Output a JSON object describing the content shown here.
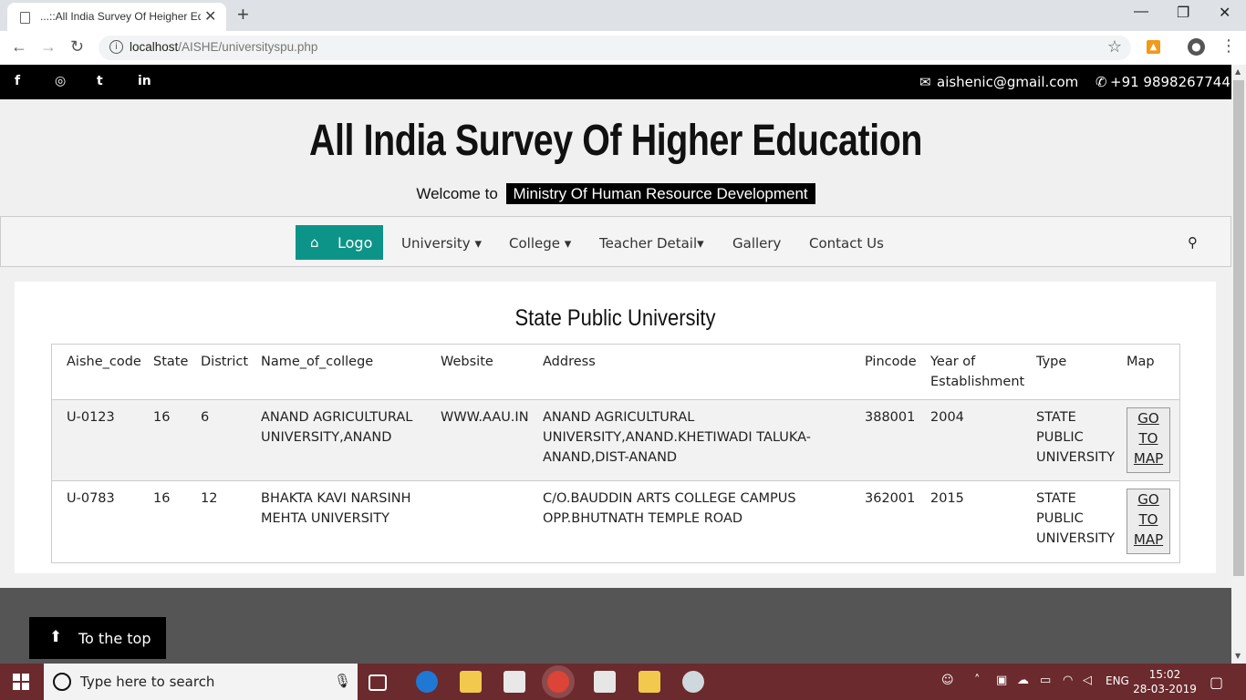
{
  "browser": {
    "tab_title": "...::All India Survey Of Heigher Ed",
    "tab_close": "✕",
    "new_tab": "+",
    "url_host": "localhost",
    "url_path": "/AISHE/universityspu.php",
    "controls": {
      "minimize": "—",
      "maximize": "❐",
      "close": "✕"
    },
    "nav": {
      "back": "←",
      "forward": "→",
      "reload": "↻"
    }
  },
  "topbar": {
    "social": [
      "f",
      "◎",
      "t",
      "in"
    ],
    "email": "aishenic@gmail.com",
    "phone": "+91 9898267744"
  },
  "header": {
    "title": "All India Survey Of Higher Education",
    "welcome": "Welcome to",
    "ministry": "Ministry Of Human Resource Development"
  },
  "nav": {
    "home": "Logo",
    "items": [
      "University",
      "College",
      "Teacher Detail",
      "Gallery",
      "Contact Us"
    ],
    "dropdown_caret": "▾"
  },
  "main": {
    "heading": "State Public University",
    "columns": [
      "Aishe_code",
      "State",
      "District",
      "Name_of_college",
      "Website",
      "Address",
      "Pincode",
      "Year of Establishment",
      "Type",
      "Map"
    ],
    "rows": [
      {
        "aishe_code": "U-0123",
        "state": "16",
        "district": "6",
        "name": "ANAND AGRICULTURAL UNIVERSITY,ANAND",
        "website": "WWW.AAU.IN",
        "address": "ANAND AGRICULTURAL UNIVERSITY,ANAND.KHETIWADI TALUKA-ANAND,DIST-ANAND",
        "pincode": "388001",
        "year": "2004",
        "type": "STATE PUBLIC UNIVERSITY",
        "map": "GO TO MAP"
      },
      {
        "aishe_code": "U-0783",
        "state": "16",
        "district": "12",
        "name": "BHAKTA KAVI NARSINH MEHTA UNIVERSITY",
        "website": "",
        "address": "C/O.BAUDDIN ARTS COLLEGE CAMPUS OPP.BHUTNATH TEMPLE ROAD",
        "pincode": "362001",
        "year": "2015",
        "type": "STATE PUBLIC UNIVERSITY",
        "map": "GO TO MAP"
      }
    ]
  },
  "to_top": "To the top",
  "taskbar": {
    "search_placeholder": "Type here to search",
    "lang": "ENG",
    "time": "15:02",
    "date": "28-03-2019"
  },
  "colors": {
    "accent": "#0d9488",
    "topbar": "#000000",
    "footer": "#555555",
    "taskbar": "#6b2a2d"
  }
}
